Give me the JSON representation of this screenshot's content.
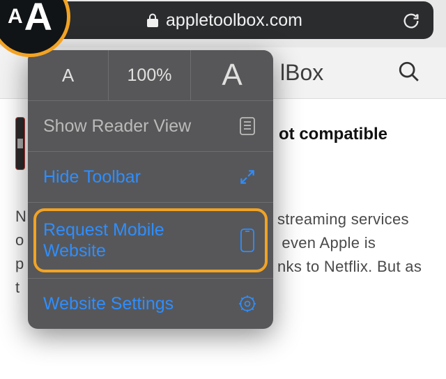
{
  "urlbar": {
    "domain": "appletoolbox.com"
  },
  "aa_button": {
    "small": "A",
    "big": "A"
  },
  "page": {
    "brand_fragment": "lBox",
    "headline_fragment": "ot compatible",
    "prefixes": {
      "l1": "N",
      "l2": "o",
      "l3": "p",
      "l4": "t"
    },
    "body_fragment": "streaming services\n even Apple is\nnks to Netflix. But as"
  },
  "popover": {
    "text_size": {
      "small": "A",
      "pct": "100%",
      "big": "A"
    },
    "reader": {
      "label": "Show Reader View"
    },
    "hide_toolbar": {
      "label": "Hide Toolbar"
    },
    "request_mobile": {
      "label": "Request Mobile\nWebsite"
    },
    "settings": {
      "label": "Website Settings"
    }
  }
}
